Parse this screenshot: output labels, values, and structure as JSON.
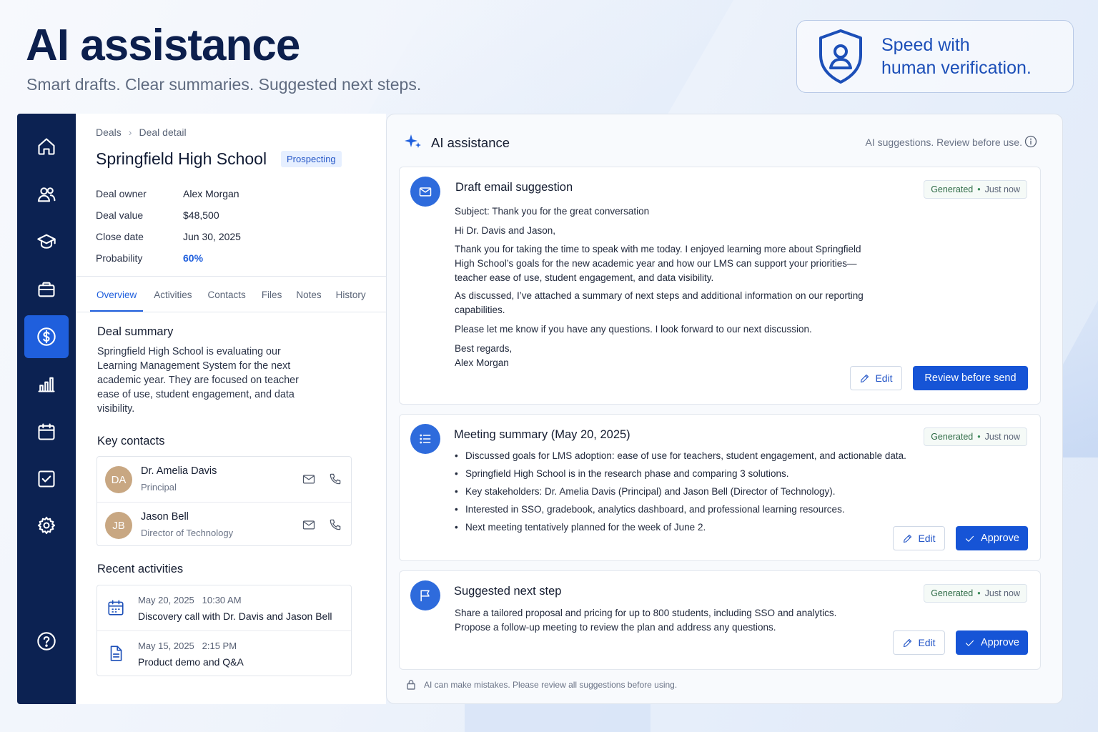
{
  "hero": {
    "title": "AI assistance",
    "subtitle": "Smart drafts. Clear summaries. Suggested next steps."
  },
  "badge": {
    "icon": "shield-user-icon",
    "line1": "Speed with",
    "line2": "human verification."
  },
  "colors": {
    "sidebar": "#0c2252",
    "accent": "#1f5fdd",
    "primary_button": "#1654d6",
    "avatar": "#c8a782"
  },
  "sidebar": {
    "items": [
      {
        "icon": "home-icon",
        "active": false
      },
      {
        "icon": "users-icon",
        "active": false
      },
      {
        "icon": "graduation-cap-icon",
        "active": false
      },
      {
        "icon": "briefcase-icon",
        "active": false
      },
      {
        "icon": "dollar-icon",
        "active": true
      },
      {
        "icon": "bar-chart-icon",
        "active": false
      },
      {
        "icon": "calendar-icon",
        "active": false
      },
      {
        "icon": "checkbox-icon",
        "active": false
      },
      {
        "icon": "gear-icon",
        "active": false
      },
      {
        "icon": "help-icon",
        "active": false
      }
    ]
  },
  "deal": {
    "breadcrumb": [
      "Deals",
      "Deal detail"
    ],
    "title": "Springfield High School",
    "stage": "Prospecting",
    "fields": [
      {
        "label": "Deal owner",
        "value": "Alex Morgan"
      },
      {
        "label": "Deal value",
        "value": "$48,500"
      },
      {
        "label": "Close date",
        "value": "Jun 30, 2025"
      },
      {
        "label": "Probability",
        "value": "60%"
      }
    ],
    "tabs": [
      "Overview",
      "Activities",
      "Contacts",
      "Files",
      "Notes",
      "History"
    ],
    "active_tab": "Overview",
    "summary_title": "Deal summary",
    "summary": "Springfield High School is evaluating our Learning Management System for the next academic year. They are focused on teacher ease of use, student engagement, and data visibility.",
    "contacts_title": "Key contacts",
    "contacts": [
      {
        "initials": "DA",
        "name": "Dr. Amelia Davis",
        "role": "Principal"
      },
      {
        "initials": "JB",
        "name": "Jason Bell",
        "role": "Director of Technology"
      }
    ],
    "activities_title": "Recent activities",
    "activities": [
      {
        "icon": "calendar-icon",
        "date": "May 20, 2025",
        "time": "10:30 AM",
        "title": "Discovery call with Dr. Davis and Jason Bell"
      },
      {
        "icon": "document-icon",
        "date": "May 15, 2025",
        "time": "2:15 PM",
        "title": "Product demo and Q&A"
      }
    ]
  },
  "ai": {
    "title": "AI assistance",
    "note": "AI suggestions. Review before use.",
    "footer": "AI can make mistakes. Please review all suggestions before using.",
    "status": "Generated",
    "status_time": "Just now",
    "email": {
      "title": "Draft email suggestion",
      "subject": "Subject: Thank you for the great conversation",
      "greeting": "Hi Dr. Davis and Jason,",
      "p1": "Thank you for taking the time to speak with me today. I enjoyed learning more about Springfield High School’s goals for the new academic year and how our LMS can support your priorities—teacher ease of use, student engagement, and data visibility.",
      "p2": "As discussed, I’ve attached a summary of next steps and additional information on our reporting capabilities.",
      "p3": "Please let me know if you have any questions. I look forward to our next discussion.",
      "signoff": "Best regards,",
      "signature": "Alex Morgan",
      "edit_label": "Edit",
      "primary_label": "Review before send"
    },
    "meeting": {
      "title": "Meeting summary (May 20, 2025)",
      "bullets": [
        "Discussed goals for LMS adoption: ease of use for teachers, student engagement, and actionable data.",
        "Springfield High School is in the research phase and comparing 3 solutions.",
        "Key stakeholders: Dr. Amelia Davis (Principal) and Jason Bell (Director of Technology).",
        "Interested in SSO, gradebook, analytics dashboard, and professional learning resources.",
        "Next meeting tentatively planned for the week of June 2."
      ],
      "edit_label": "Edit",
      "primary_label": "Approve"
    },
    "next_step": {
      "title": "Suggested next step",
      "line1": "Share a tailored proposal and pricing for up to 800 students, including SSO and analytics.",
      "line2": "Propose a follow-up meeting to review the plan and address any questions.",
      "edit_label": "Edit",
      "primary_label": "Approve"
    }
  }
}
